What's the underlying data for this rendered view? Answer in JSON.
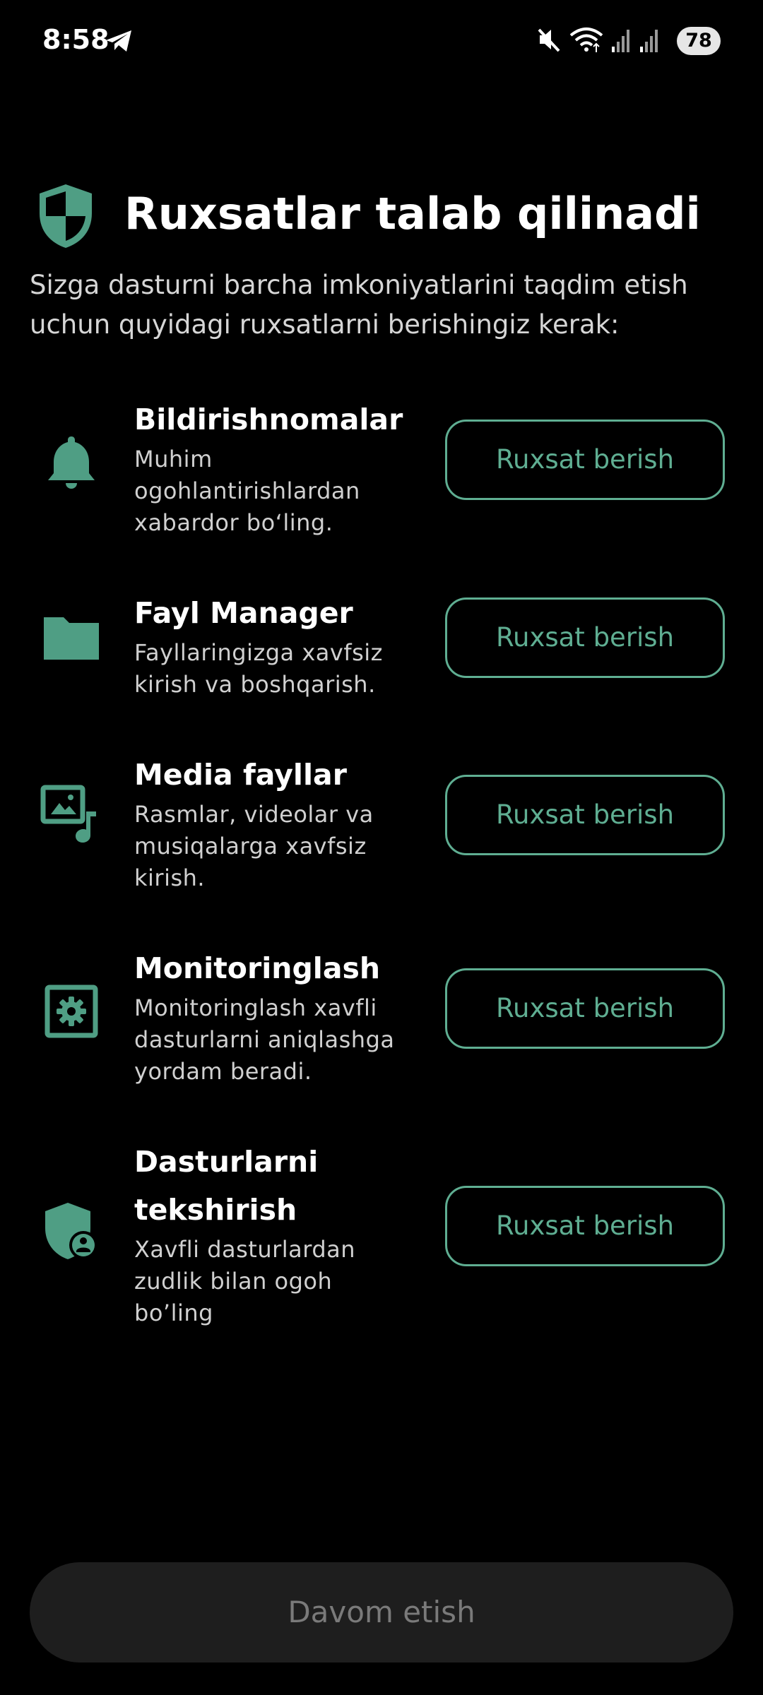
{
  "status_bar": {
    "time": "8:58",
    "battery": "78",
    "icons": [
      "telegram-icon",
      "mute-icon",
      "wifi-icon",
      "signal-icon",
      "signal-icon",
      "battery-icon"
    ]
  },
  "header": {
    "title": "Ruxsatlar talab qilinadi",
    "subtitle": "Sizga dasturni barcha imkoniyatlarini taqdim etish uchun quyidagi ruxsatlarni berishingiz kerak:",
    "icon": "shield-icon"
  },
  "permissions": [
    {
      "icon": "bell-icon",
      "title": "Bildirishnomalar",
      "description": "Muhim ogohlantirishlardan xabardor bo‘ling.",
      "button": "Ruxsat berish"
    },
    {
      "icon": "folder-icon",
      "title": "Fayl Manager",
      "description": "Fayllaringizga xavfsiz kirish va boshqarish.",
      "button": "Ruxsat berish"
    },
    {
      "icon": "media-icon",
      "title": "Media fayllar",
      "description": "Rasmlar, videolar va musiqalarga xavfsiz kirish.",
      "button": "Ruxsat berish"
    },
    {
      "icon": "monitoring-icon",
      "title": "Monitoringlash",
      "description": "Monitoringlash xavfli dasturlarni aniqlashga yordam beradi.",
      "button": "Ruxsat berish"
    },
    {
      "icon": "shield-user-icon",
      "title": "Dasturlarni tekshirish",
      "description": "Xavfli dasturlardan zudlik bilan ogoh bo’ling",
      "button": "Ruxsat berish"
    }
  ],
  "footer": {
    "continue_label": "Davom etish"
  },
  "colors": {
    "background": "#000000",
    "accent": "#5fae92",
    "icon": "#4f9e84",
    "disabled_button_bg": "#1e1e1e",
    "disabled_button_text": "#7a7a7a"
  }
}
